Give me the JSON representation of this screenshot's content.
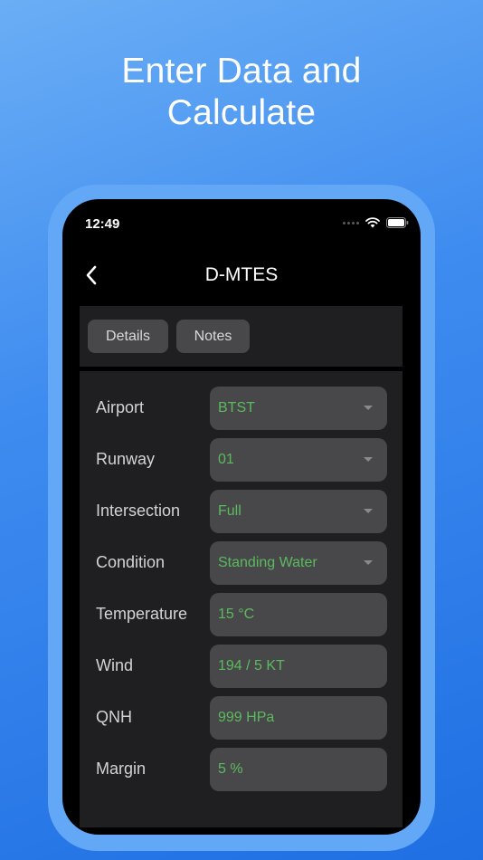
{
  "headline": {
    "line1": "Enter Data and",
    "line2": "Calculate"
  },
  "status_bar": {
    "time": "12:49",
    "icons": [
      "signal-dots-icon",
      "wifi-icon",
      "battery-icon"
    ]
  },
  "nav": {
    "back_icon": "chevron-left-icon",
    "title": "D-MTES"
  },
  "tabs": [
    {
      "label": "Details"
    },
    {
      "label": "Notes"
    }
  ],
  "form": {
    "fields": [
      {
        "label": "Airport",
        "value": "BTST",
        "type": "dropdown"
      },
      {
        "label": "Runway",
        "value": "01",
        "type": "dropdown"
      },
      {
        "label": "Intersection",
        "value": "Full",
        "type": "dropdown"
      },
      {
        "label": "Condition",
        "value": "Standing Water",
        "type": "dropdown"
      },
      {
        "label": "Temperature",
        "value": "15 °C",
        "type": "input"
      },
      {
        "label": "Wind",
        "value": "194 / 5 KT",
        "type": "input"
      },
      {
        "label": "QNH",
        "value": "999 HPa",
        "type": "input"
      },
      {
        "label": "Margin",
        "value": "5 %",
        "type": "input"
      }
    ]
  },
  "colors": {
    "background_gradient_start": "#6aaef5",
    "background_gradient_end": "#1f6fe3",
    "phone_frame": "#62a8f6",
    "panel": "#1f1f22",
    "control": "#48484b",
    "value_text": "#5cba5e",
    "label_text": "#d3d3d3"
  }
}
